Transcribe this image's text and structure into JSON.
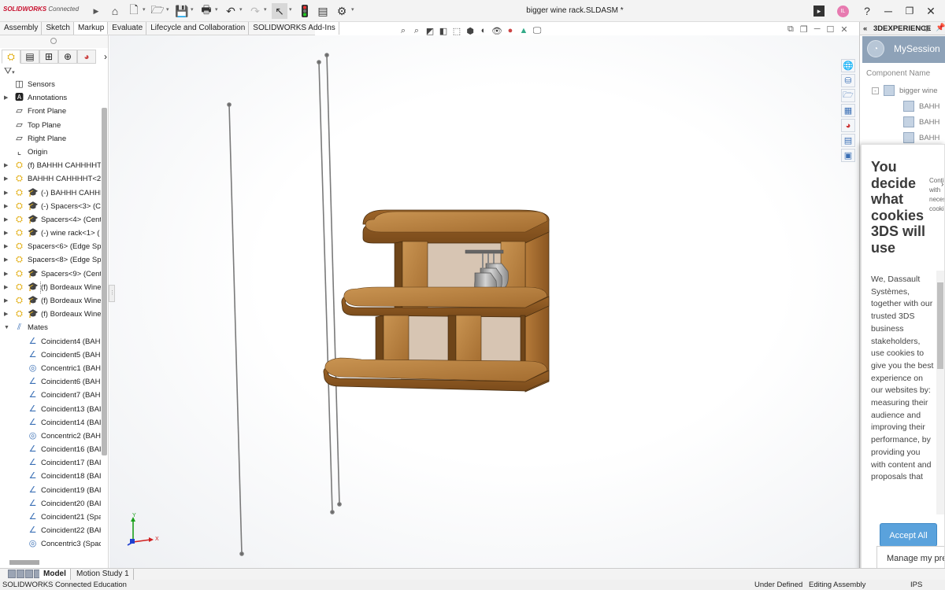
{
  "app": {
    "logo_brand": "SOLIDWORKS",
    "logo_suffix": "Connected",
    "document_title": "bigger wine rack.SLDASM *",
    "user_initials": "IL"
  },
  "command_tabs": [
    "Assembly",
    "Sketch",
    "Markup",
    "Evaluate",
    "Lifecycle and Collaboration",
    "SOLIDWORKS Add-Ins"
  ],
  "active_command_tab": "Markup",
  "feature_tree": {
    "items": [
      {
        "label": "Sensors",
        "icon": "sensor-icon",
        "expandable": false,
        "sub_icon": false
      },
      {
        "label": "Annotations",
        "icon": "annotations-icon",
        "expandable": true,
        "sub_icon": false
      },
      {
        "label": "Front Plane",
        "icon": "plane-icon",
        "expandable": false,
        "sub_icon": false
      },
      {
        "label": "Top Plane",
        "icon": "plane-icon",
        "expandable": false,
        "sub_icon": false
      },
      {
        "label": "Right Plane",
        "icon": "plane-icon",
        "expandable": false,
        "sub_icon": false
      },
      {
        "label": "Origin",
        "icon": "origin-icon",
        "expandable": false,
        "sub_icon": false
      },
      {
        "label": "(f) BAHHH CAHHHHT<",
        "icon": "part-icon",
        "expandable": true,
        "sub_icon": false
      },
      {
        "label": "BAHHH CAHHHHT<2>",
        "icon": "part-icon",
        "expandable": true,
        "sub_icon": false
      },
      {
        "label": "(-) BAHHH CAHHHHT",
        "icon": "part-icon",
        "expandable": true,
        "sub_icon": true
      },
      {
        "label": "(-) Spacers<3> (Cent",
        "icon": "part-icon",
        "expandable": true,
        "sub_icon": true
      },
      {
        "label": "Spacers<4> (Center",
        "icon": "part-icon",
        "expandable": true,
        "sub_icon": true
      },
      {
        "label": "(-) wine rack<1> (",
        "icon": "part-icon",
        "expandable": true,
        "sub_icon": true
      },
      {
        "label": "Spacers<6> (Edge Spa",
        "icon": "part-icon",
        "expandable": true,
        "sub_icon": false
      },
      {
        "label": "Spacers<8> (Edge Spa",
        "icon": "part-icon",
        "expandable": true,
        "sub_icon": false
      },
      {
        "label": "Spacers<9> (Center",
        "icon": "part-icon",
        "expandable": true,
        "sub_icon": true
      },
      {
        "label": "(f) Bordeaux Wine",
        "icon": "part-icon",
        "expandable": true,
        "sub_icon": true,
        "selected": true
      },
      {
        "label": "(f) Bordeaux Wine",
        "icon": "part-icon",
        "expandable": true,
        "sub_icon": true
      },
      {
        "label": "(f) Bordeaux Wine",
        "icon": "part-icon",
        "expandable": true,
        "sub_icon": true
      },
      {
        "label": "Mates",
        "icon": "mates-icon",
        "expandable": true,
        "expanded": true,
        "sub_icon": false
      }
    ],
    "mates": [
      {
        "label": "Coincident4 (BAH",
        "type": "coincident"
      },
      {
        "label": "Coincident5 (BAH",
        "type": "coincident"
      },
      {
        "label": "Concentric1 (BAH",
        "type": "concentric"
      },
      {
        "label": "Coincident6 (BAH",
        "type": "coincident"
      },
      {
        "label": "Coincident7 (BAH",
        "type": "coincident"
      },
      {
        "label": "Coincident13 (BAI",
        "type": "coincident"
      },
      {
        "label": "Coincident14 (BAI",
        "type": "coincident"
      },
      {
        "label": "Concentric2 (BAH",
        "type": "concentric"
      },
      {
        "label": "Coincident16 (BAI",
        "type": "coincident"
      },
      {
        "label": "Coincident17 (BAI",
        "type": "coincident"
      },
      {
        "label": "Coincident18 (BAI",
        "type": "coincident"
      },
      {
        "label": "Coincident19 (BAI",
        "type": "coincident"
      },
      {
        "label": "Coincident20 (BAI",
        "type": "coincident"
      },
      {
        "label": "Coincident21 (Spa",
        "type": "coincident"
      },
      {
        "label": "Coincident22 (BAH",
        "type": "coincident"
      },
      {
        "label": "Concentric3 (Spac",
        "type": "concentric"
      }
    ]
  },
  "bottom_tabs": [
    "Model",
    "Motion Study 1"
  ],
  "active_bottom_tab": "Model",
  "status": {
    "left": "SOLIDWORKS Connected Education",
    "state": "Under Defined",
    "mode": "Editing Assembly",
    "units": "IPS"
  },
  "triad": {
    "y": "Y",
    "x": "X"
  },
  "right_panel": {
    "header": "3DEXPERIENCE",
    "session": "MySession",
    "column_header": "Component Name",
    "rows": [
      "bigger wine",
      "BAHH",
      "BAHH",
      "BAHH"
    ]
  },
  "cookie": {
    "title": "You decide what cookies 3DS will use",
    "side_text": "Conti with necess cooki",
    "body": "We, Dassault Systèmes, together with our trusted 3DS business stakeholders, use cookies to give you the best experience on our websites by: measuring their audience and improving their performance, by providing you with content and proposals that",
    "accept_label": "Accept All",
    "manage_label": "Manage my pre"
  },
  "colors": {
    "accent": "#5aa2dc",
    "wood": "#a8702f",
    "wood_light": "#c58d48",
    "wood_dark": "#6b4519"
  }
}
